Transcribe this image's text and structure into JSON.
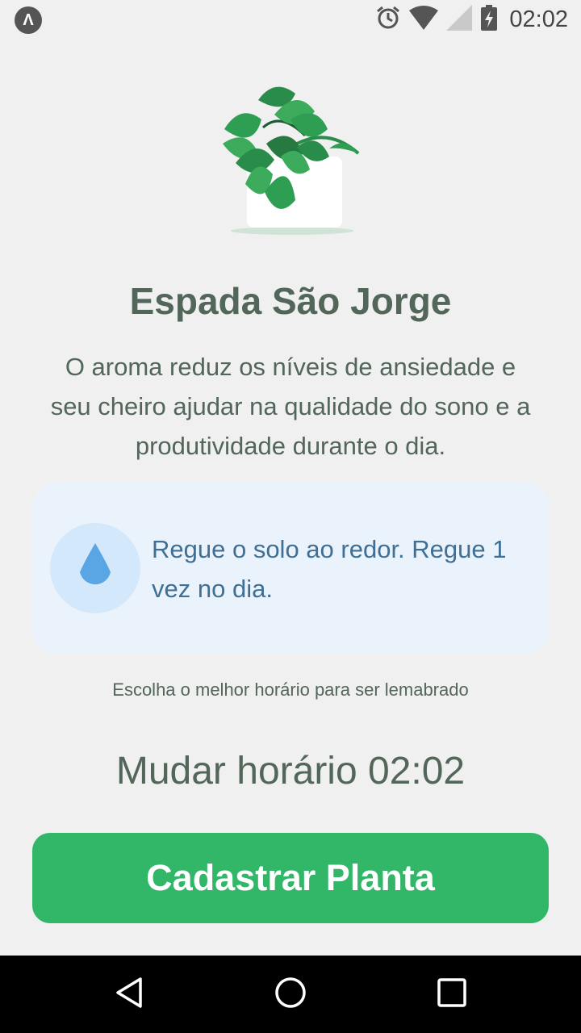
{
  "status_bar": {
    "app_badge": "Λ",
    "time": "02:02",
    "icons": [
      "alarm-icon",
      "wifi-icon",
      "signal-icon",
      "battery-charging-icon"
    ]
  },
  "plant": {
    "name": "Espada São Jorge",
    "about": "O aroma reduz os níveis de ansiedade e seu cheiro ajudar na qualidade do sono e a produtividade durante o dia.",
    "water_tip": "Regue o solo ao redor. Regue 1 vez no dia."
  },
  "reminder": {
    "hint": "Escolha o melhor horário para ser lemabrado",
    "change_time_label": "Mudar horário 02:02"
  },
  "actions": {
    "submit_label": "Cadastrar Planta"
  },
  "nav": {
    "icons": [
      "back-icon",
      "home-icon",
      "recents-icon"
    ]
  },
  "colors": {
    "background": "#f0f0f0",
    "heading": "#52665a",
    "tip_card": "#eaf3fc",
    "tip_text": "#3f6f95",
    "primary_button": "#32b768"
  }
}
